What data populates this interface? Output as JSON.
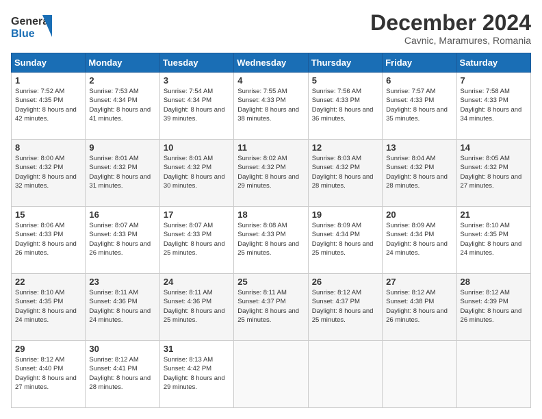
{
  "header": {
    "logo_line1": "General",
    "logo_line2": "Blue",
    "month": "December 2024",
    "location": "Cavnic, Maramures, Romania"
  },
  "weekdays": [
    "Sunday",
    "Monday",
    "Tuesday",
    "Wednesday",
    "Thursday",
    "Friday",
    "Saturday"
  ],
  "weeks": [
    [
      {
        "day": "1",
        "rise": "Sunrise: 7:52 AM",
        "set": "Sunset: 4:35 PM",
        "daylight": "Daylight: 8 hours and 42 minutes."
      },
      {
        "day": "2",
        "rise": "Sunrise: 7:53 AM",
        "set": "Sunset: 4:34 PM",
        "daylight": "Daylight: 8 hours and 41 minutes."
      },
      {
        "day": "3",
        "rise": "Sunrise: 7:54 AM",
        "set": "Sunset: 4:34 PM",
        "daylight": "Daylight: 8 hours and 39 minutes."
      },
      {
        "day": "4",
        "rise": "Sunrise: 7:55 AM",
        "set": "Sunset: 4:33 PM",
        "daylight": "Daylight: 8 hours and 38 minutes."
      },
      {
        "day": "5",
        "rise": "Sunrise: 7:56 AM",
        "set": "Sunset: 4:33 PM",
        "daylight": "Daylight: 8 hours and 36 minutes."
      },
      {
        "day": "6",
        "rise": "Sunrise: 7:57 AM",
        "set": "Sunset: 4:33 PM",
        "daylight": "Daylight: 8 hours and 35 minutes."
      },
      {
        "day": "7",
        "rise": "Sunrise: 7:58 AM",
        "set": "Sunset: 4:33 PM",
        "daylight": "Daylight: 8 hours and 34 minutes."
      }
    ],
    [
      {
        "day": "8",
        "rise": "Sunrise: 8:00 AM",
        "set": "Sunset: 4:32 PM",
        "daylight": "Daylight: 8 hours and 32 minutes."
      },
      {
        "day": "9",
        "rise": "Sunrise: 8:01 AM",
        "set": "Sunset: 4:32 PM",
        "daylight": "Daylight: 8 hours and 31 minutes."
      },
      {
        "day": "10",
        "rise": "Sunrise: 8:01 AM",
        "set": "Sunset: 4:32 PM",
        "daylight": "Daylight: 8 hours and 30 minutes."
      },
      {
        "day": "11",
        "rise": "Sunrise: 8:02 AM",
        "set": "Sunset: 4:32 PM",
        "daylight": "Daylight: 8 hours and 29 minutes."
      },
      {
        "day": "12",
        "rise": "Sunrise: 8:03 AM",
        "set": "Sunset: 4:32 PM",
        "daylight": "Daylight: 8 hours and 28 minutes."
      },
      {
        "day": "13",
        "rise": "Sunrise: 8:04 AM",
        "set": "Sunset: 4:32 PM",
        "daylight": "Daylight: 8 hours and 28 minutes."
      },
      {
        "day": "14",
        "rise": "Sunrise: 8:05 AM",
        "set": "Sunset: 4:32 PM",
        "daylight": "Daylight: 8 hours and 27 minutes."
      }
    ],
    [
      {
        "day": "15",
        "rise": "Sunrise: 8:06 AM",
        "set": "Sunset: 4:33 PM",
        "daylight": "Daylight: 8 hours and 26 minutes."
      },
      {
        "day": "16",
        "rise": "Sunrise: 8:07 AM",
        "set": "Sunset: 4:33 PM",
        "daylight": "Daylight: 8 hours and 26 minutes."
      },
      {
        "day": "17",
        "rise": "Sunrise: 8:07 AM",
        "set": "Sunset: 4:33 PM",
        "daylight": "Daylight: 8 hours and 25 minutes."
      },
      {
        "day": "18",
        "rise": "Sunrise: 8:08 AM",
        "set": "Sunset: 4:33 PM",
        "daylight": "Daylight: 8 hours and 25 minutes."
      },
      {
        "day": "19",
        "rise": "Sunrise: 8:09 AM",
        "set": "Sunset: 4:34 PM",
        "daylight": "Daylight: 8 hours and 25 minutes."
      },
      {
        "day": "20",
        "rise": "Sunrise: 8:09 AM",
        "set": "Sunset: 4:34 PM",
        "daylight": "Daylight: 8 hours and 24 minutes."
      },
      {
        "day": "21",
        "rise": "Sunrise: 8:10 AM",
        "set": "Sunset: 4:35 PM",
        "daylight": "Daylight: 8 hours and 24 minutes."
      }
    ],
    [
      {
        "day": "22",
        "rise": "Sunrise: 8:10 AM",
        "set": "Sunset: 4:35 PM",
        "daylight": "Daylight: 8 hours and 24 minutes."
      },
      {
        "day": "23",
        "rise": "Sunrise: 8:11 AM",
        "set": "Sunset: 4:36 PM",
        "daylight": "Daylight: 8 hours and 24 minutes."
      },
      {
        "day": "24",
        "rise": "Sunrise: 8:11 AM",
        "set": "Sunset: 4:36 PM",
        "daylight": "Daylight: 8 hours and 25 minutes."
      },
      {
        "day": "25",
        "rise": "Sunrise: 8:11 AM",
        "set": "Sunset: 4:37 PM",
        "daylight": "Daylight: 8 hours and 25 minutes."
      },
      {
        "day": "26",
        "rise": "Sunrise: 8:12 AM",
        "set": "Sunset: 4:37 PM",
        "daylight": "Daylight: 8 hours and 25 minutes."
      },
      {
        "day": "27",
        "rise": "Sunrise: 8:12 AM",
        "set": "Sunset: 4:38 PM",
        "daylight": "Daylight: 8 hours and 26 minutes."
      },
      {
        "day": "28",
        "rise": "Sunrise: 8:12 AM",
        "set": "Sunset: 4:39 PM",
        "daylight": "Daylight: 8 hours and 26 minutes."
      }
    ],
    [
      {
        "day": "29",
        "rise": "Sunrise: 8:12 AM",
        "set": "Sunset: 4:40 PM",
        "daylight": "Daylight: 8 hours and 27 minutes."
      },
      {
        "day": "30",
        "rise": "Sunrise: 8:12 AM",
        "set": "Sunset: 4:41 PM",
        "daylight": "Daylight: 8 hours and 28 minutes."
      },
      {
        "day": "31",
        "rise": "Sunrise: 8:13 AM",
        "set": "Sunset: 4:42 PM",
        "daylight": "Daylight: 8 hours and 29 minutes."
      },
      null,
      null,
      null,
      null
    ]
  ]
}
